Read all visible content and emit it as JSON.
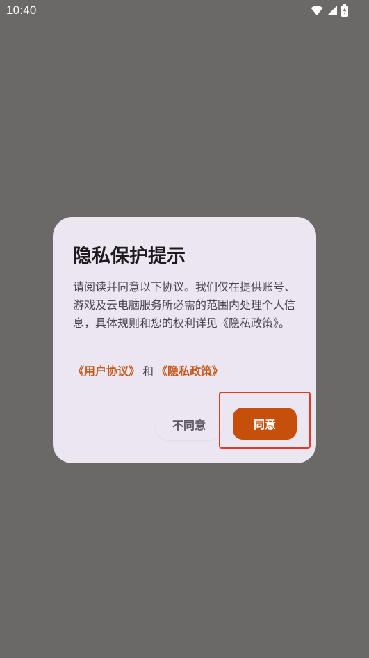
{
  "status_bar": {
    "time": "10:40",
    "icons": [
      "wifi-icon",
      "signal-icon",
      "battery-charging-icon"
    ]
  },
  "dialog": {
    "title": "隐私保护提示",
    "body": "请阅读并同意以下协议。我们仅在提供账号、游戏及云电脑服务所必需的范围内处理个人信息，具体规则和您的权利详见《隐私政策》。",
    "user_agreement_link": "《用户协议》",
    "and_text": "和",
    "privacy_policy_link": "《隐私政策》",
    "disagree_label": "不同意",
    "agree_label": "同意"
  },
  "colors": {
    "backdrop": "#6a6968",
    "dialog_bg": "#ece6f0",
    "accent": "#c64f0c",
    "link": "#c65a1e",
    "highlight": "#e03a2a"
  }
}
